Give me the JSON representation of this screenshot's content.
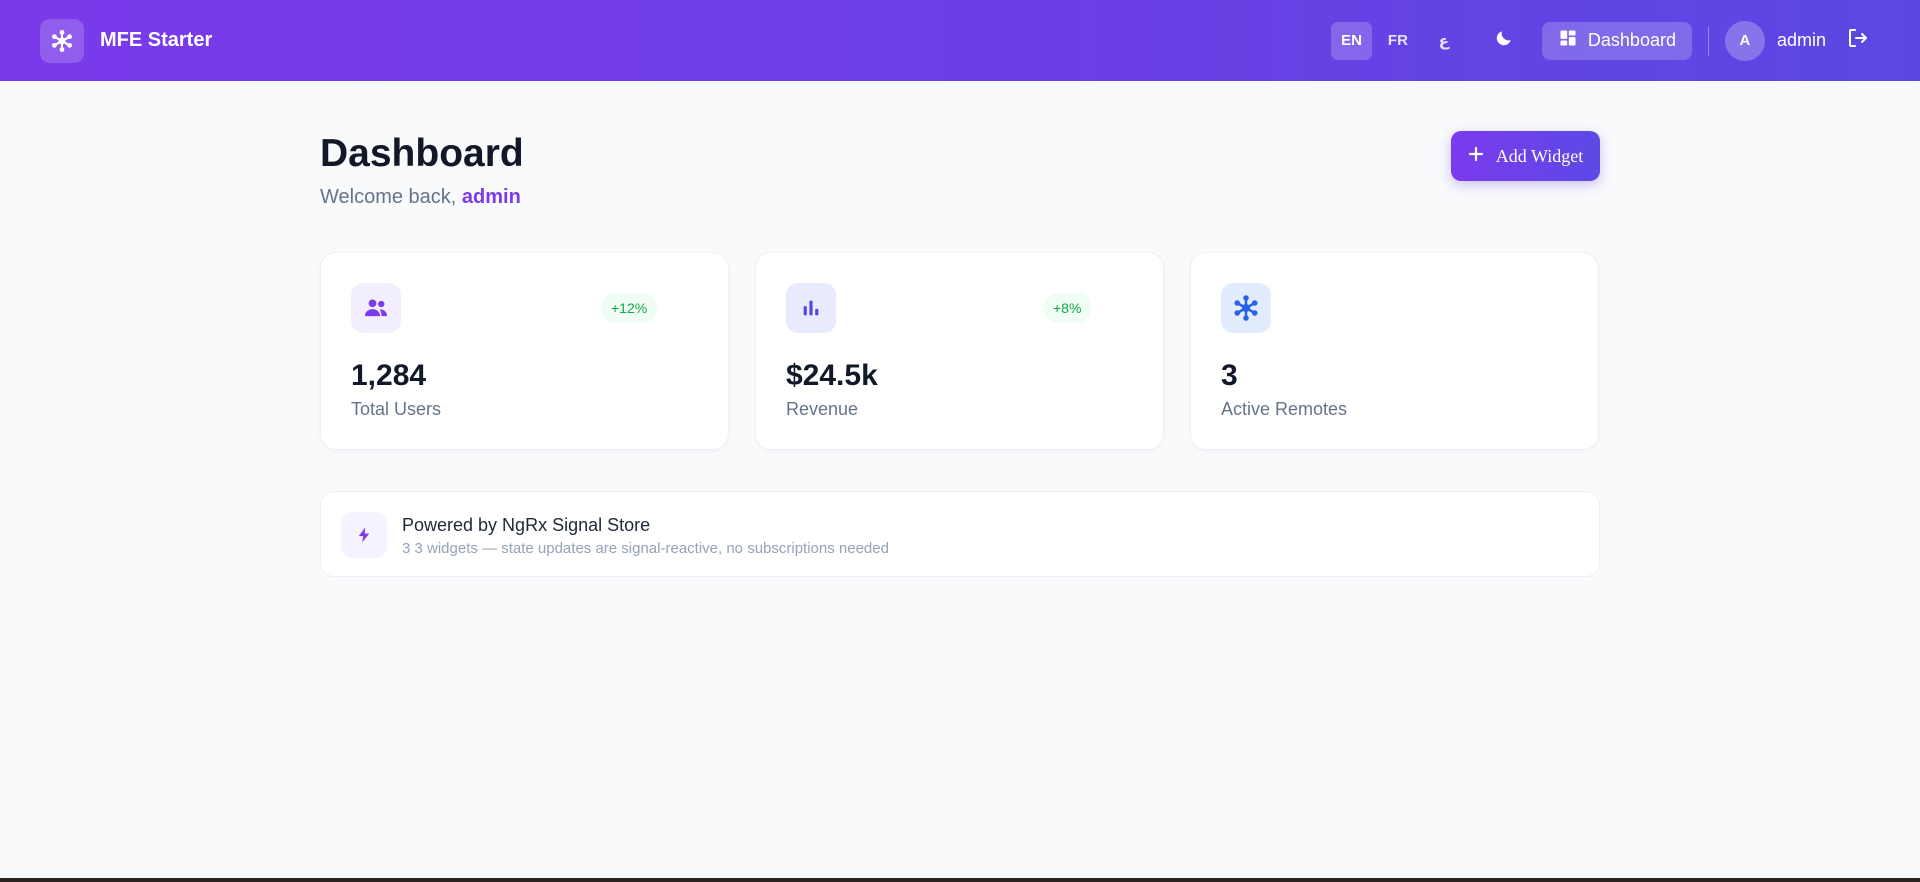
{
  "header": {
    "brand": "MFE Starter",
    "languages": [
      "EN",
      "FR",
      "ع"
    ],
    "active_language": "EN",
    "nav_dashboard": "Dashboard",
    "avatar_initial": "A",
    "username": "admin"
  },
  "main": {
    "title": "Dashboard",
    "welcome_prefix": "Welcome back, ",
    "welcome_user": "admin",
    "add_widget": "Add Widget"
  },
  "stats": [
    {
      "icon": "users-icon",
      "value": "1,284",
      "label": "Total Users",
      "trend": "+12%"
    },
    {
      "icon": "bar-chart-icon",
      "value": "$24.5k",
      "label": "Revenue",
      "trend": "+8%"
    },
    {
      "icon": "network-icon",
      "value": "3",
      "label": "Active Remotes"
    }
  ],
  "info": {
    "title": "Powered by NgRx Signal Store",
    "subtitle": "3 3 widgets — state updates are signal-reactive, no subscriptions needed"
  },
  "colors": {
    "accent": "#7c3aed",
    "header_start": "#7a3aea",
    "header_end": "#5b48e3",
    "trend_text": "#16a34a",
    "trend_bg": "#f0fdf4"
  }
}
